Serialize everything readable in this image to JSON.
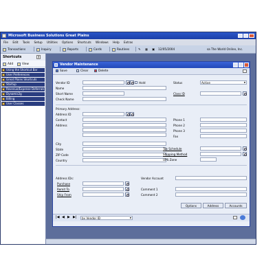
{
  "app": {
    "title": "Microsoft Business Solutions Great Plains",
    "menu": [
      "File",
      "Edit",
      "Tools",
      "Setup",
      "Utilities",
      "Options",
      "Shortcuts",
      "Windows",
      "Help",
      "Extras"
    ],
    "toolbar": {
      "transactions": "Transactions",
      "inquiry": "Inquiry",
      "reports": "Reports",
      "cards": "Cards",
      "routines": "Routines",
      "date": "12/05/2004",
      "company": "sa  The World Online, Inc."
    }
  },
  "sidebar": {
    "title": "Shortcuts",
    "help": "?",
    "add_label": "Add",
    "view_label": "View",
    "items": [
      "Using the Shortcut Bar",
      "User Preferences",
      "Great Plains Shortcuts",
      "Startup",
      "Revenue/Expense Deferrals",
      "Dynamic2g",
      "Billing",
      "User Classes"
    ]
  },
  "window": {
    "title": "Vendor Maintenance",
    "toolbar": {
      "save": "Save",
      "clear": "Clear",
      "delete": "Delete"
    },
    "labels": {
      "vendor_id": "Vendor ID",
      "hold": "Hold",
      "name": "Name",
      "short_name": "Short Name",
      "check_name": "Check Name",
      "status": "Status",
      "class_id": "Class ID",
      "primary_address": "Primary Address:",
      "address_id": "Address ID",
      "contact": "Contact",
      "address": "Address",
      "city": "City",
      "state": "State",
      "zip": "ZIP Code",
      "country": "Country",
      "phone1": "Phone 1",
      "phone2": "Phone 2",
      "phone3": "Phone 3",
      "fax": "Fax",
      "tax_schedule": "Tax Schedule",
      "shipping_method": "Shipping Method",
      "ups_zone": "UPS Zone",
      "address_ids": "Address IDs:",
      "purchase": "Purchase",
      "remit_to": "Remit To",
      "ship_from": "Ship From",
      "vendor_account": "Vendor Account",
      "comment1": "Comment 1",
      "comment2": "Comment 2"
    },
    "values": {
      "status": "Active"
    },
    "buttons": {
      "options": "Options",
      "address": "Address",
      "accounts": "Accounts"
    },
    "nav": {
      "sort_by": "by Vendor ID"
    }
  }
}
